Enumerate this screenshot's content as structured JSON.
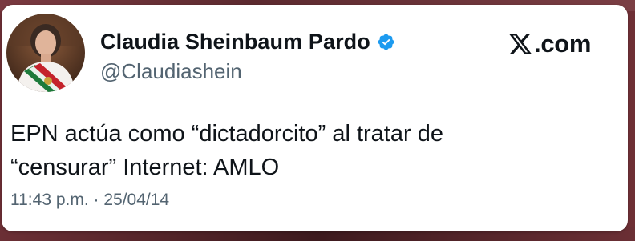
{
  "author": {
    "display_name": "Claudia Sheinbaum Pardo",
    "handle": "@Claudiashein",
    "verified": true,
    "avatar": "profile-photo"
  },
  "brand": {
    "logo_icon": "x-logo-icon",
    "site": "com"
  },
  "tweet": {
    "lines": [
      "EPN actúa como “dictadorcito” al tratar de",
      "“censurar” Internet: AMLO"
    ],
    "timestamp": "11:43 p.m. · 25/04/14"
  },
  "colors": {
    "verified_badge": "#1d9bf0",
    "text_primary": "#0f1419",
    "text_secondary": "#536471",
    "background": "#6e2f35"
  }
}
